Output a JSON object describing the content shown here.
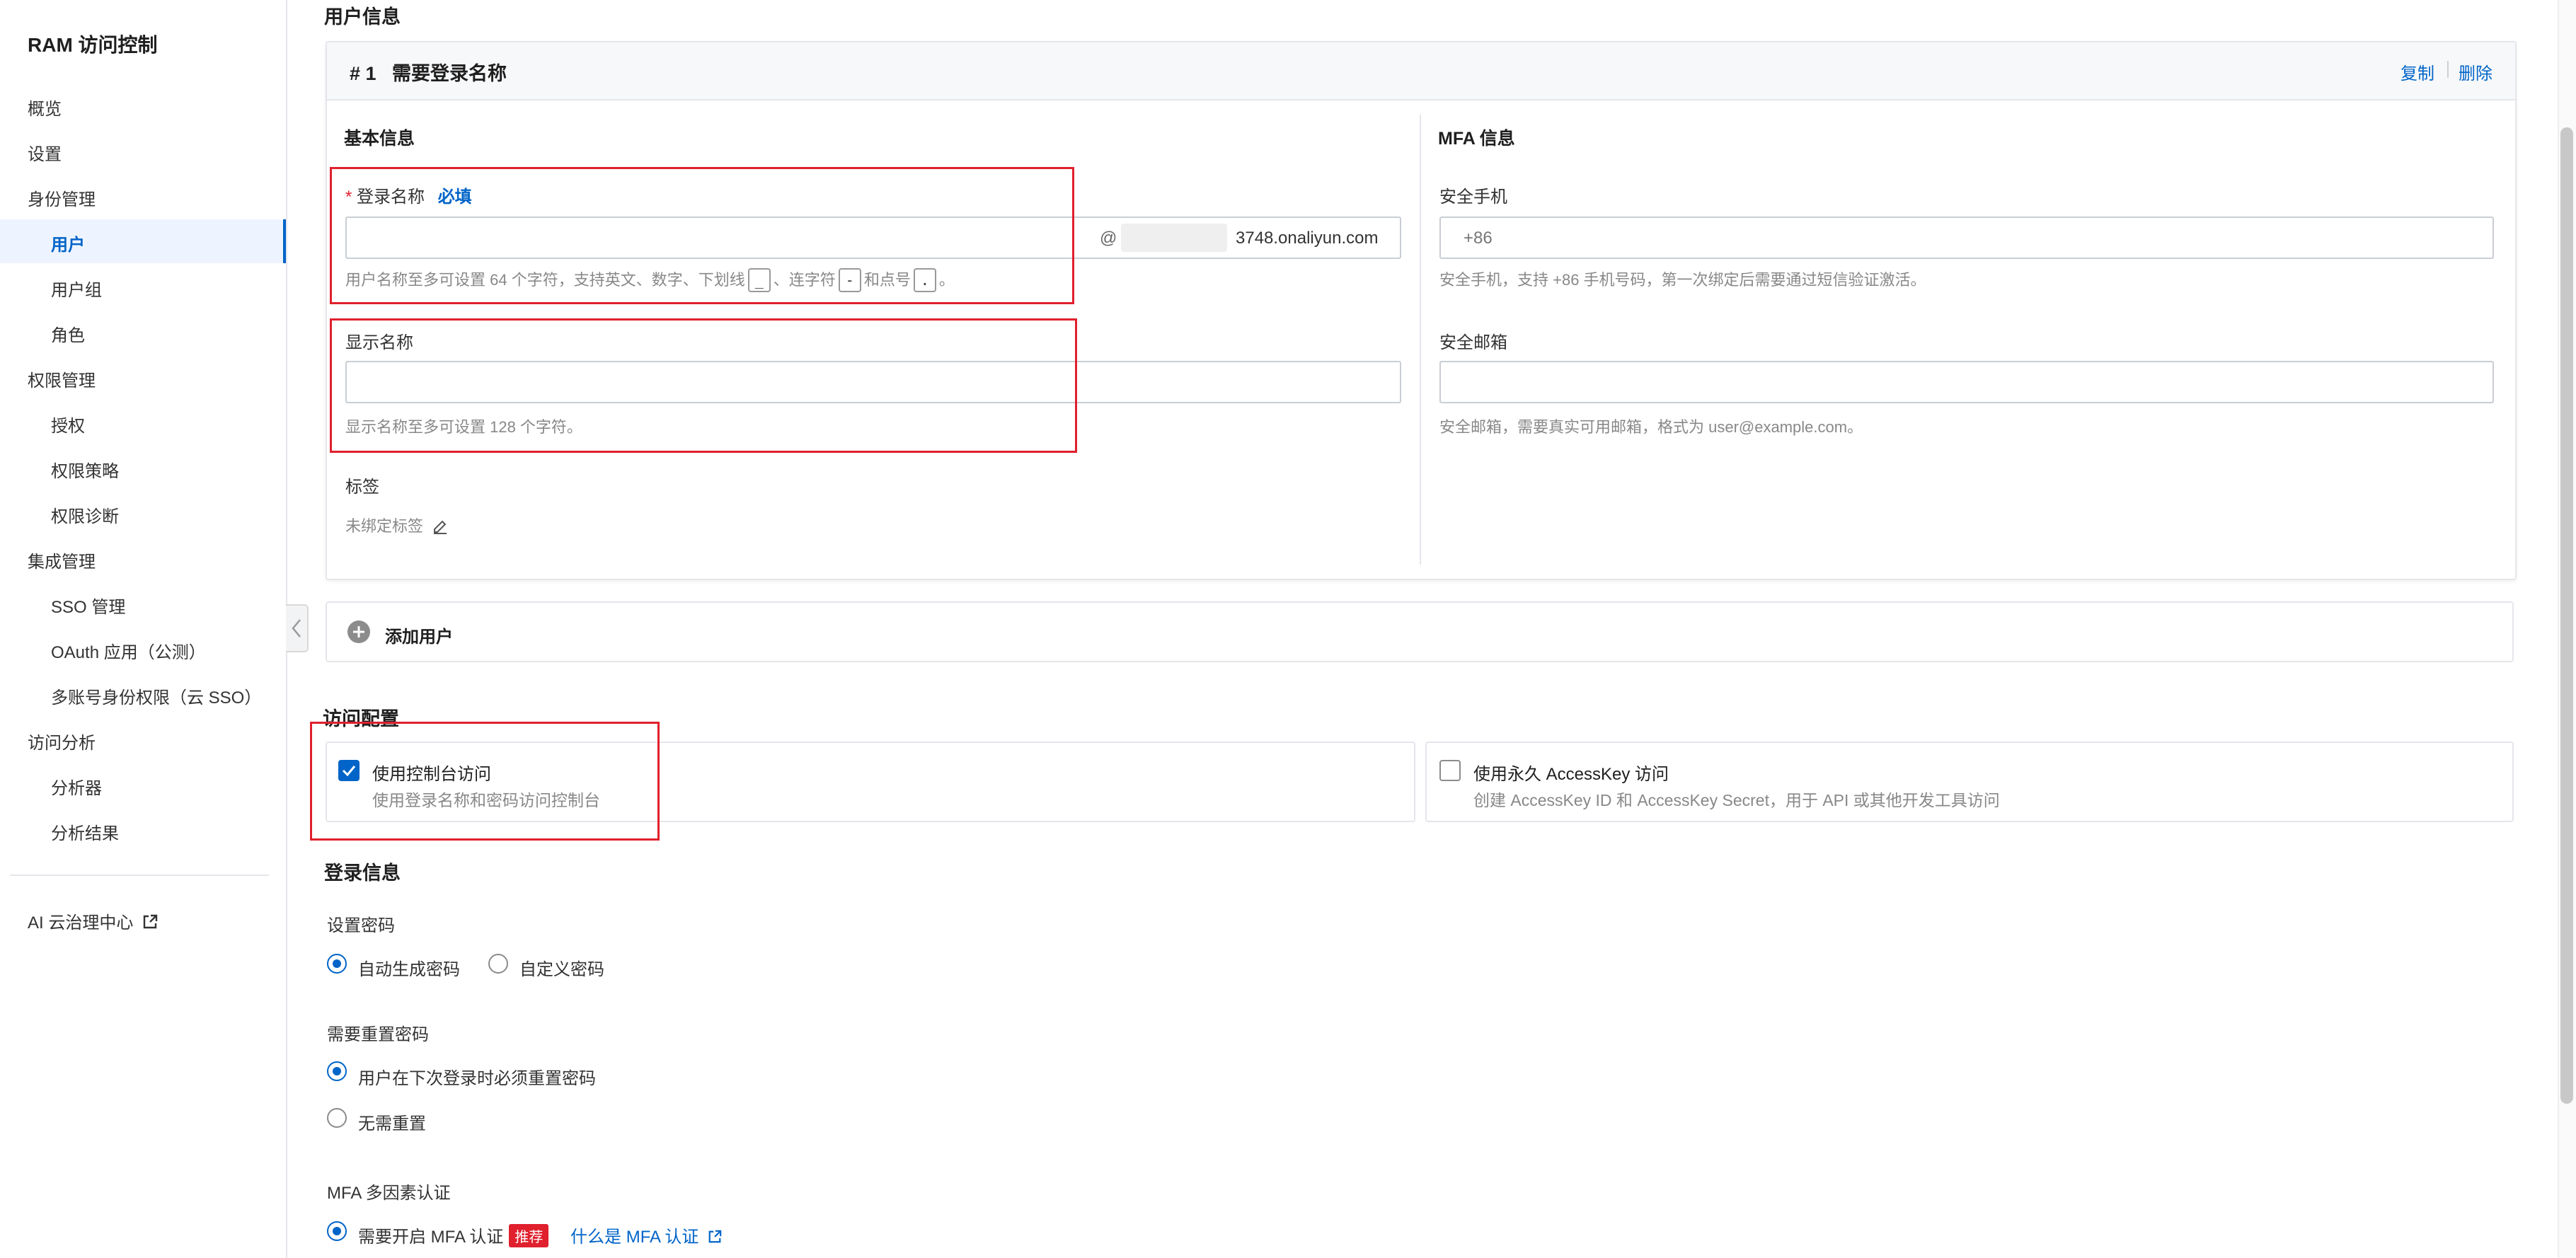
{
  "sidebar": {
    "title": "RAM 访问控制",
    "items": [
      {
        "label": "概览"
      },
      {
        "label": "设置"
      },
      {
        "label": "身份管理"
      },
      {
        "label": "用户"
      },
      {
        "label": "用户组"
      },
      {
        "label": "角色"
      },
      {
        "label": "权限管理"
      },
      {
        "label": "授权"
      },
      {
        "label": "权限策略"
      },
      {
        "label": "权限诊断"
      },
      {
        "label": "集成管理"
      },
      {
        "label": "SSO 管理"
      },
      {
        "label": "OAuth 应用（公测）"
      },
      {
        "label": "多账号身份权限（云 SSO）"
      },
      {
        "label": "访问分析"
      },
      {
        "label": "分析器"
      },
      {
        "label": "分析结果"
      }
    ],
    "ai_center": "AI 云治理中心"
  },
  "user_info": {
    "section_title": "用户信息",
    "card_title": "# 1   需要登录名称",
    "copy": "复制",
    "delete": "删除",
    "basic_title": "基本信息",
    "login_name_label": "登录名称",
    "required": "必填",
    "login_name_value": "",
    "domain_at": "@",
    "domain_suffix": "3748.onaliyun.com",
    "login_hint_prefix": "用户名称至多可设置 64 个字符，支持英文、数字、下划线",
    "login_hint_key1": "_",
    "login_hint_sep1": "、连字符",
    "login_hint_key2": "-",
    "login_hint_sep2": "和点号",
    "login_hint_key3": ".",
    "login_hint_end": "。",
    "display_name_label": "显示名称",
    "display_name_value": "",
    "display_hint": "显示名称至多可设置 128 个字符。",
    "tags_label": "标签",
    "tags_value": "未绑定标签",
    "mfa_title": "MFA 信息",
    "phone_label": "安全手机",
    "phone_placeholder": "+86",
    "phone_hint": "安全手机，支持 +86 手机号码，第一次绑定后需要通过短信验证激活。",
    "email_label": "安全邮箱",
    "email_value": "",
    "email_hint": "安全邮箱，需要真实可用邮箱，格式为 user@example.com。"
  },
  "add_user": "添加用户",
  "access": {
    "title": "访问配置",
    "console_label": "使用控制台访问",
    "console_desc": "使用登录名称和密码访问控制台",
    "console_checked": true,
    "ak_label": "使用永久 AccessKey 访问",
    "ak_desc": "创建 AccessKey ID 和 AccessKey Secret，用于 API 或其他开发工具访问",
    "ak_checked": false
  },
  "login": {
    "title": "登录信息",
    "password_label": "设置密码",
    "auto_password": "自动生成密码",
    "custom_password": "自定义密码",
    "reset_label": "需要重置密码",
    "reset_required": "用户在下次登录时必须重置密码",
    "reset_none": "无需重置",
    "mfa_label": "MFA 多因素认证",
    "mfa_required": "需要开启 MFA 认证",
    "mfa_badge": "推荐",
    "mfa_link": "什么是 MFA 认证"
  },
  "colors": {
    "accent": "#0064c8",
    "highlight_box": "#e0202d",
    "badge": "#e0202d"
  }
}
